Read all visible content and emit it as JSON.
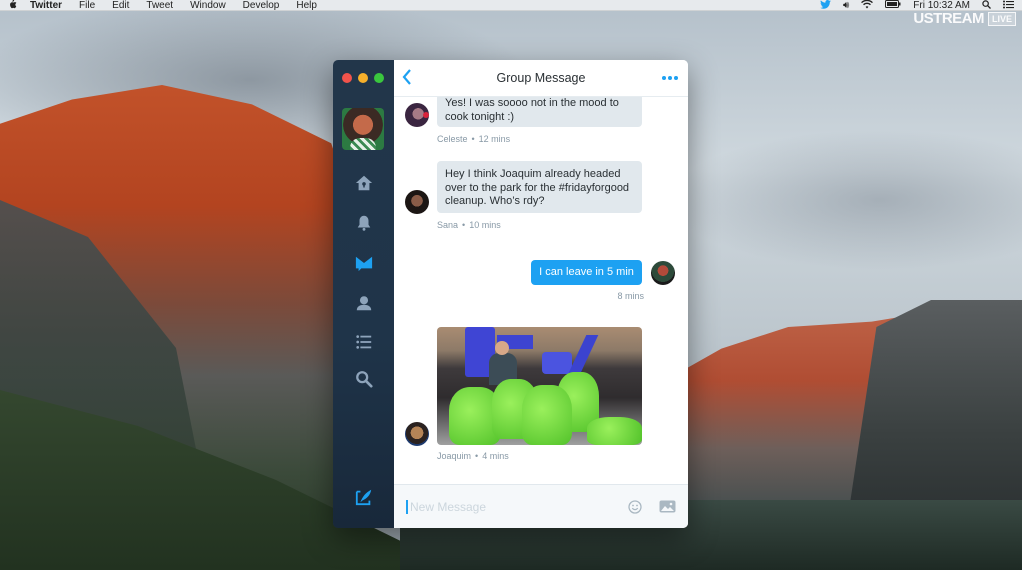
{
  "menubar": {
    "apple_icon": "apple-icon",
    "items": [
      "Twitter",
      "File",
      "Edit",
      "Tweet",
      "Window",
      "Develop",
      "Help"
    ],
    "status": {
      "twitter_icon": "twitter-bird-icon",
      "volume_icon": "volume-icon",
      "wifi_icon": "wifi-icon",
      "battery_icon": "battery-icon",
      "clock": "Fri 10:32 AM",
      "search_icon": "spotlight-search-icon",
      "notifications_icon": "notification-center-icon"
    }
  },
  "overlay": {
    "brand": "USTREAM",
    "live_badge": "LIVE"
  },
  "window": {
    "title": "Group Message",
    "back_icon": "chevron-left-icon",
    "more_icon": "more-dots-icon",
    "sidebar": {
      "items": [
        {
          "name": "home",
          "icon": "home-icon",
          "active": false
        },
        {
          "name": "notifications",
          "icon": "bell-icon",
          "active": false
        },
        {
          "name": "messages",
          "icon": "envelope-icon",
          "active": true
        },
        {
          "name": "profile",
          "icon": "person-icon",
          "active": false
        },
        {
          "name": "lists",
          "icon": "list-icon",
          "active": false
        },
        {
          "name": "search",
          "icon": "search-icon",
          "active": false
        }
      ],
      "compose_icon": "compose-tweet-icon",
      "colors": {
        "active": "#1da1f2",
        "inactive": "#8ea4bb",
        "background": "#22364a"
      }
    },
    "messages": [
      {
        "sender": "Celeste",
        "time": "12 mins",
        "text": "Yes! I was soooo not in the mood to cook tonight :)",
        "mine": false
      },
      {
        "sender": "Sana",
        "time": "10 mins",
        "text": "Hey I think Joaquim already headed over to the park for the #fridayforgood cleanup. Who’s rdy?",
        "mine": false
      },
      {
        "sender": "",
        "time": "8 mins",
        "text": "I can leave in 5 min",
        "mine": true
      },
      {
        "sender": "Joaquim",
        "time": "4 mins",
        "text": "",
        "mine": false,
        "attachment": "photo of green trash bags at a playground"
      }
    ],
    "composer": {
      "placeholder": "New Message",
      "value": "",
      "emoji_icon": "emoji-icon",
      "image_icon": "image-icon"
    },
    "colors": {
      "accent": "#1da1f2",
      "bubble": "#e1e8ed",
      "meta_text": "#8899a6"
    }
  }
}
